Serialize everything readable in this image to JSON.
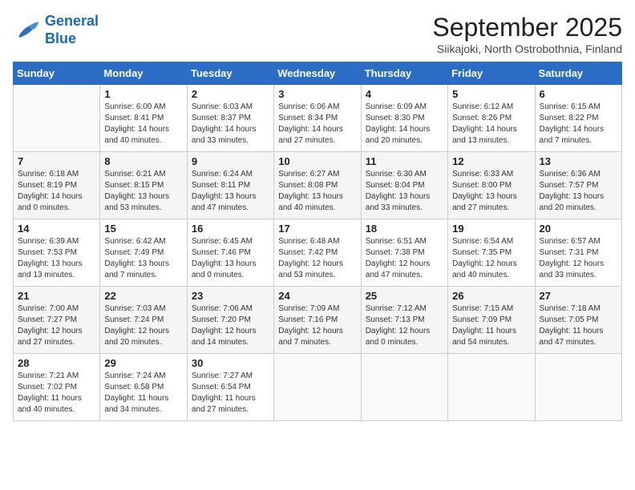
{
  "logo": {
    "line1": "General",
    "line2": "Blue"
  },
  "title": "September 2025",
  "subtitle": "Siikajoki, North Ostrobothnia, Finland",
  "days_of_week": [
    "Sunday",
    "Monday",
    "Tuesday",
    "Wednesday",
    "Thursday",
    "Friday",
    "Saturday"
  ],
  "weeks": [
    [
      {
        "num": "",
        "detail": ""
      },
      {
        "num": "1",
        "detail": "Sunrise: 6:00 AM\nSunset: 8:41 PM\nDaylight: 14 hours\nand 40 minutes."
      },
      {
        "num": "2",
        "detail": "Sunrise: 6:03 AM\nSunset: 8:37 PM\nDaylight: 14 hours\nand 33 minutes."
      },
      {
        "num": "3",
        "detail": "Sunrise: 6:06 AM\nSunset: 8:34 PM\nDaylight: 14 hours\nand 27 minutes."
      },
      {
        "num": "4",
        "detail": "Sunrise: 6:09 AM\nSunset: 8:30 PM\nDaylight: 14 hours\nand 20 minutes."
      },
      {
        "num": "5",
        "detail": "Sunrise: 6:12 AM\nSunset: 8:26 PM\nDaylight: 14 hours\nand 13 minutes."
      },
      {
        "num": "6",
        "detail": "Sunrise: 6:15 AM\nSunset: 8:22 PM\nDaylight: 14 hours\nand 7 minutes."
      }
    ],
    [
      {
        "num": "7",
        "detail": "Sunrise: 6:18 AM\nSunset: 8:19 PM\nDaylight: 14 hours\nand 0 minutes."
      },
      {
        "num": "8",
        "detail": "Sunrise: 6:21 AM\nSunset: 8:15 PM\nDaylight: 13 hours\nand 53 minutes."
      },
      {
        "num": "9",
        "detail": "Sunrise: 6:24 AM\nSunset: 8:11 PM\nDaylight: 13 hours\nand 47 minutes."
      },
      {
        "num": "10",
        "detail": "Sunrise: 6:27 AM\nSunset: 8:08 PM\nDaylight: 13 hours\nand 40 minutes."
      },
      {
        "num": "11",
        "detail": "Sunrise: 6:30 AM\nSunset: 8:04 PM\nDaylight: 13 hours\nand 33 minutes."
      },
      {
        "num": "12",
        "detail": "Sunrise: 6:33 AM\nSunset: 8:00 PM\nDaylight: 13 hours\nand 27 minutes."
      },
      {
        "num": "13",
        "detail": "Sunrise: 6:36 AM\nSunset: 7:57 PM\nDaylight: 13 hours\nand 20 minutes."
      }
    ],
    [
      {
        "num": "14",
        "detail": "Sunrise: 6:39 AM\nSunset: 7:53 PM\nDaylight: 13 hours\nand 13 minutes."
      },
      {
        "num": "15",
        "detail": "Sunrise: 6:42 AM\nSunset: 7:49 PM\nDaylight: 13 hours\nand 7 minutes."
      },
      {
        "num": "16",
        "detail": "Sunrise: 6:45 AM\nSunset: 7:46 PM\nDaylight: 13 hours\nand 0 minutes."
      },
      {
        "num": "17",
        "detail": "Sunrise: 6:48 AM\nSunset: 7:42 PM\nDaylight: 12 hours\nand 53 minutes."
      },
      {
        "num": "18",
        "detail": "Sunrise: 6:51 AM\nSunset: 7:38 PM\nDaylight: 12 hours\nand 47 minutes."
      },
      {
        "num": "19",
        "detail": "Sunrise: 6:54 AM\nSunset: 7:35 PM\nDaylight: 12 hours\nand 40 minutes."
      },
      {
        "num": "20",
        "detail": "Sunrise: 6:57 AM\nSunset: 7:31 PM\nDaylight: 12 hours\nand 33 minutes."
      }
    ],
    [
      {
        "num": "21",
        "detail": "Sunrise: 7:00 AM\nSunset: 7:27 PM\nDaylight: 12 hours\nand 27 minutes."
      },
      {
        "num": "22",
        "detail": "Sunrise: 7:03 AM\nSunset: 7:24 PM\nDaylight: 12 hours\nand 20 minutes."
      },
      {
        "num": "23",
        "detail": "Sunrise: 7:06 AM\nSunset: 7:20 PM\nDaylight: 12 hours\nand 14 minutes."
      },
      {
        "num": "24",
        "detail": "Sunrise: 7:09 AM\nSunset: 7:16 PM\nDaylight: 12 hours\nand 7 minutes."
      },
      {
        "num": "25",
        "detail": "Sunrise: 7:12 AM\nSunset: 7:13 PM\nDaylight: 12 hours\nand 0 minutes."
      },
      {
        "num": "26",
        "detail": "Sunrise: 7:15 AM\nSunset: 7:09 PM\nDaylight: 11 hours\nand 54 minutes."
      },
      {
        "num": "27",
        "detail": "Sunrise: 7:18 AM\nSunset: 7:05 PM\nDaylight: 11 hours\nand 47 minutes."
      }
    ],
    [
      {
        "num": "28",
        "detail": "Sunrise: 7:21 AM\nSunset: 7:02 PM\nDaylight: 11 hours\nand 40 minutes."
      },
      {
        "num": "29",
        "detail": "Sunrise: 7:24 AM\nSunset: 6:58 PM\nDaylight: 11 hours\nand 34 minutes."
      },
      {
        "num": "30",
        "detail": "Sunrise: 7:27 AM\nSunset: 6:54 PM\nDaylight: 11 hours\nand 27 minutes."
      },
      {
        "num": "",
        "detail": ""
      },
      {
        "num": "",
        "detail": ""
      },
      {
        "num": "",
        "detail": ""
      },
      {
        "num": "",
        "detail": ""
      }
    ]
  ]
}
